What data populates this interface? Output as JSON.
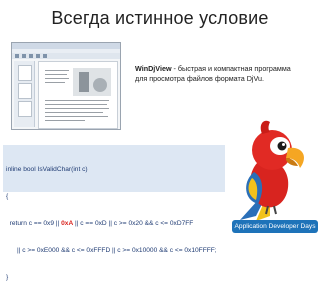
{
  "slide": {
    "title": "Всегда истинное условие"
  },
  "description": {
    "app_name": "WinDjView",
    "line1_rest": " - быстрая и компактная программа",
    "line2": "для просмотра файлов формата DjVu."
  },
  "code": {
    "line1": "inline bool IsValidChar(int c)",
    "line2": "{",
    "line3_before": "  return c == 0x9 || ",
    "line3_highlight": "0xA",
    "line3_after": " || c == 0xD || c >= 0x20 && c <= 0xD7FF",
    "line4": "      || c >= 0xE000 && c <= 0xFFFD || c >= 0x10000 && c <= 0x10FFFF;",
    "line5": "}"
  },
  "footer": {
    "badge_text": "Application Developer Days"
  },
  "colors": {
    "code_background": "#dde7f3",
    "highlight": "#d9231e",
    "badge": "#1e73b9"
  },
  "icons": {
    "mascot": "parrot-mascot-icon"
  }
}
